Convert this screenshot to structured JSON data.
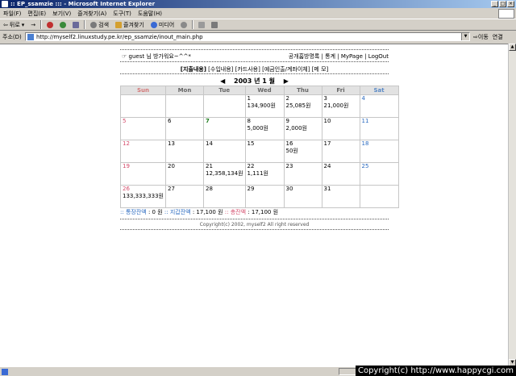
{
  "window": {
    "title": ":: EP_ssamzie ::: - Microsoft Internet Explorer",
    "buttons": [
      "_",
      "□",
      "×"
    ]
  },
  "menu": [
    "파일(F)",
    "편집(E)",
    "보기(V)",
    "즐겨찾기(A)",
    "도구(T)",
    "도움말(H)"
  ],
  "toolbar": {
    "back": "뒤로",
    "forward": "→",
    "search": "검색",
    "favorites": "즐겨찾기",
    "media": "미디어"
  },
  "address": {
    "label": "주소(D)",
    "url": "http://myself2.linuxstudy.pe.kr/ep_ssamzie/inout_main.php",
    "go": "이동",
    "links": "연결"
  },
  "page": {
    "greeting": "guest 님 방가워요~^^*",
    "nav": [
      "공개홈방명록",
      "통계",
      "MyPage",
      "LogOut"
    ],
    "tabs": {
      "active": "[지출내용]",
      "others": [
        "[수입내용]",
        "[카드사용]",
        "[예금인출/계좌이체]",
        "[메 모]"
      ]
    },
    "month": {
      "prev": "◀",
      "label": "2003 년 1 월",
      "next": "▶"
    },
    "weekdays": [
      "Sun",
      "Mon",
      "Tue",
      "Wed",
      "Thu",
      "Fri",
      "Sat"
    ],
    "weeks": [
      [
        {
          "d": ""
        },
        {
          "d": ""
        },
        {
          "d": ""
        },
        {
          "d": "1",
          "amt": "134,900원"
        },
        {
          "d": "2",
          "amt": "25,085원"
        },
        {
          "d": "3",
          "amt": "21,000원"
        },
        {
          "d": "4"
        }
      ],
      [
        {
          "d": "5"
        },
        {
          "d": "6"
        },
        {
          "d": "7"
        },
        {
          "d": "8",
          "amt": "5,000원"
        },
        {
          "d": "9",
          "amt": "2,000원"
        },
        {
          "d": "10"
        },
        {
          "d": "11"
        }
      ],
      [
        {
          "d": "12"
        },
        {
          "d": "13"
        },
        {
          "d": "14"
        },
        {
          "d": "15"
        },
        {
          "d": "16",
          "amt": "50원"
        },
        {
          "d": "17"
        },
        {
          "d": "18"
        }
      ],
      [
        {
          "d": "19"
        },
        {
          "d": "20"
        },
        {
          "d": "21",
          "amt": "12,358,134원"
        },
        {
          "d": "22",
          "amt": "1,111원"
        },
        {
          "d": "23"
        },
        {
          "d": "24"
        },
        {
          "d": "25"
        }
      ],
      [
        {
          "d": "26",
          "amt": "133,333,333원"
        },
        {
          "d": "27"
        },
        {
          "d": "28"
        },
        {
          "d": "29"
        },
        {
          "d": "30"
        },
        {
          "d": "31"
        },
        {
          "d": ""
        }
      ]
    ],
    "summary": {
      "bank_label": ":: 통장잔액",
      "bank_value": ": 0 원",
      "wallet_label": ":: 지갑잔액",
      "wallet_value": ": 17,100 원",
      "total_label": ":: 총잔액",
      "total_value": ": 17,100 원"
    },
    "footer": "Copyright(c) 2002, myself2 All right reserved"
  },
  "watermark": "Copyright(c) http://www.happycgi.com",
  "colors": {
    "title_bar": "#0a246a",
    "sunday": "#d44a6a",
    "saturday": "#2a6ac0",
    "holiday": "#1a7a1a"
  }
}
